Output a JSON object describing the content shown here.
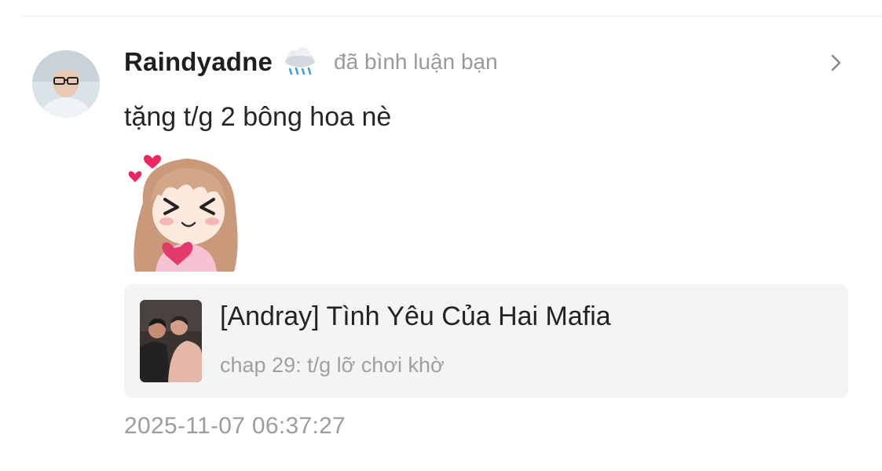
{
  "notification": {
    "user": {
      "name": "Raindyadne",
      "badge_icon": "rain-cloud-icon",
      "avatar_icon": "user-avatar"
    },
    "action_text": "đã bình luận bạn",
    "comment_text": "tặng t/g 2 bông hoa nè",
    "sticker_icon": "chibi-girl-heart-sticker",
    "story": {
      "title": "[Andray] Tình Yêu Của Hai Mafia",
      "chapter": "chap 29: t/g lỡ chơi khờ",
      "cover_icon": "story-cover-image"
    },
    "timestamp": "2025-11-07 06:37:27"
  },
  "colors": {
    "text_primary": "#1f1f1f",
    "text_secondary": "#9a9a9a",
    "card_bg": "#f4f4f4",
    "heart": "#f0245f"
  }
}
